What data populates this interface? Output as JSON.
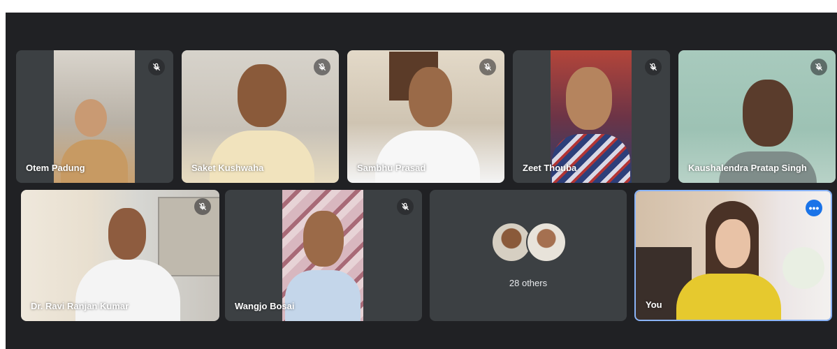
{
  "meeting": {
    "participants_row1": [
      {
        "name": "Otem Padung",
        "muted": true
      },
      {
        "name": "Saket Kushwaha",
        "muted": true
      },
      {
        "name": "Sambhu Prasad",
        "muted": true
      },
      {
        "name": "Zeet Thouba",
        "muted": true
      },
      {
        "name": "Kaushalendra Pratap Singh",
        "muted": true
      }
    ],
    "participants_row2": [
      {
        "name": "Dr. Ravi Ranjan Kumar",
        "muted": true
      },
      {
        "name": "Wangjo Bosai",
        "muted": true
      }
    ],
    "others": {
      "label": "28 others"
    },
    "self": {
      "name": "You",
      "more_options_icon": "more-horiz-icon"
    },
    "icons": {
      "muted": "mic-off-icon"
    },
    "colors": {
      "background": "#202124",
      "tile": "#3c4043",
      "self_border": "#8ab4f8",
      "accent": "#1a73e8"
    }
  }
}
